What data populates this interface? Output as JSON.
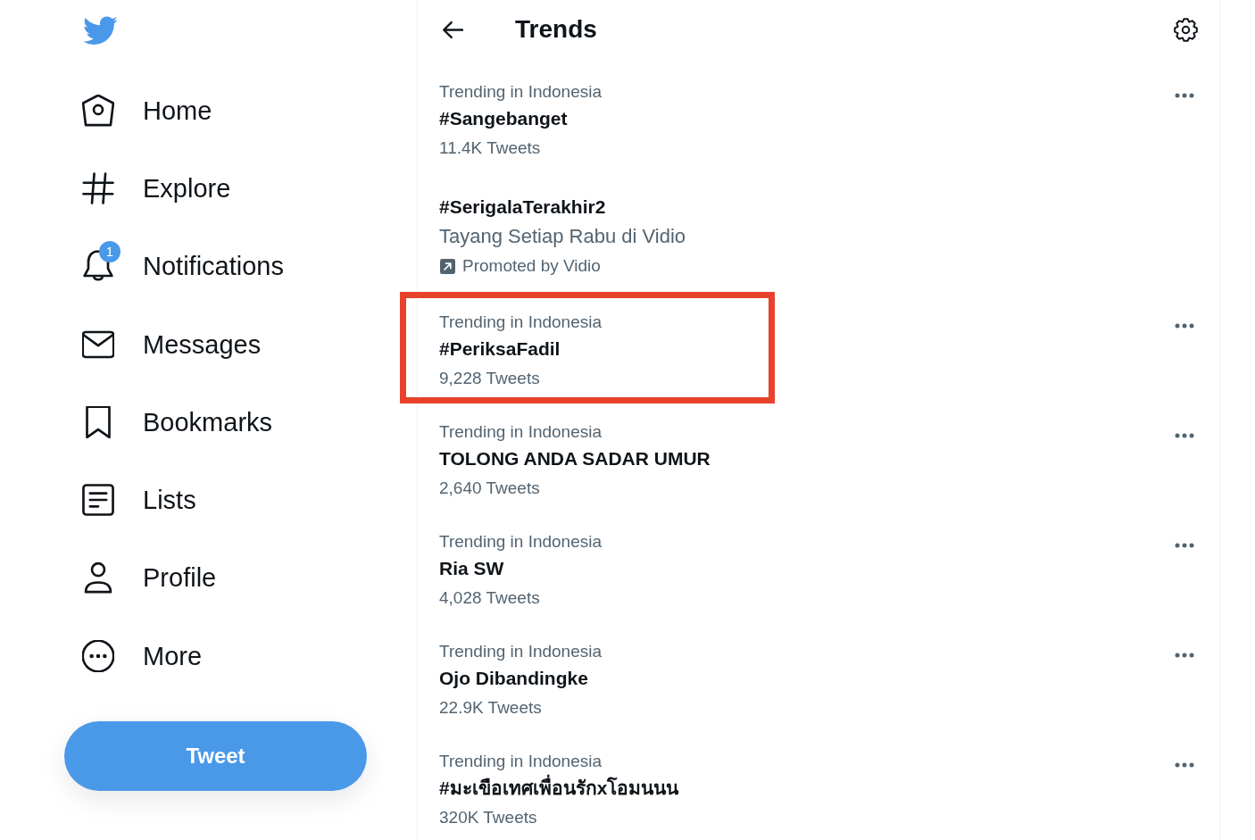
{
  "sidebar": {
    "nav": [
      {
        "kind": "home",
        "label": "Home"
      },
      {
        "kind": "explore",
        "label": "Explore"
      },
      {
        "kind": "notifications",
        "label": "Notifications",
        "badge": "1"
      },
      {
        "kind": "messages",
        "label": "Messages"
      },
      {
        "kind": "bookmarks",
        "label": "Bookmarks"
      },
      {
        "kind": "lists",
        "label": "Lists"
      },
      {
        "kind": "profile",
        "label": "Profile"
      },
      {
        "kind": "more",
        "label": "More"
      }
    ],
    "tweet_button": "Tweet"
  },
  "main": {
    "header": {
      "title": "Trends"
    },
    "trends": [
      {
        "kind": "trend",
        "context": "Trending in Indonesia",
        "title": "#Sangebanget",
        "count": "11.4K Tweets",
        "highlighted": false
      },
      {
        "kind": "promoted",
        "title": "#SerigalaTerakhir2",
        "description": "Tayang Setiap Rabu di Vidio",
        "promoted_by": "Promoted by Vidio",
        "highlighted": false
      },
      {
        "kind": "trend",
        "context": "Trending in Indonesia",
        "title": "#PeriksaFadil",
        "count": "9,228 Tweets",
        "highlighted": true
      },
      {
        "kind": "trend",
        "context": "Trending in Indonesia",
        "title": "TOLONG ANDA SADAR UMUR",
        "count": "2,640 Tweets",
        "highlighted": false
      },
      {
        "kind": "trend",
        "context": "Trending in Indonesia",
        "title": "Ria SW",
        "count": "4,028 Tweets",
        "highlighted": false
      },
      {
        "kind": "trend",
        "context": "Trending in Indonesia",
        "title": "Ojo Dibandingke",
        "count": "22.9K Tweets",
        "highlighted": false
      },
      {
        "kind": "trend",
        "context": "Trending in Indonesia",
        "title": "#มะเขือเทศเพื่อนรักxโอมนนน",
        "count": "320K Tweets",
        "highlighted": false
      }
    ]
  }
}
